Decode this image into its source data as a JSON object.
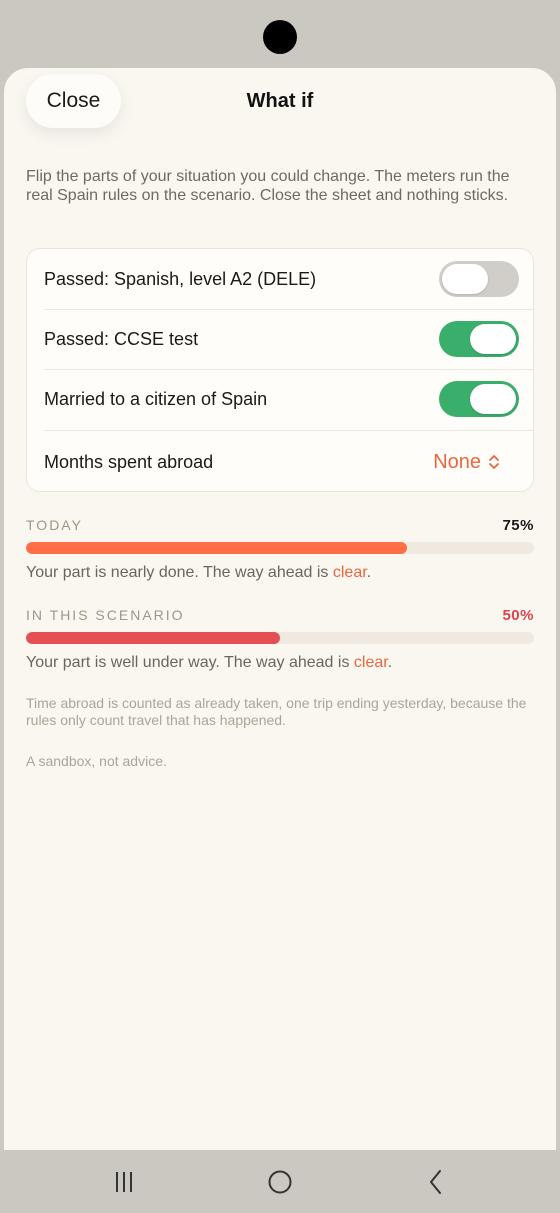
{
  "header": {
    "close_label": "Close",
    "title": "What if"
  },
  "intro": "Flip the parts of your situation you could change. The meters run the real Spain rules on the scenario. Close the sheet and nothing sticks.",
  "options": [
    {
      "label": "Passed: Spanish, level A2 (DELE)",
      "toggle": false
    },
    {
      "label": "Passed: CCSE test",
      "toggle": true
    },
    {
      "label": "Married to a citizen of Spain",
      "toggle": true
    }
  ],
  "months_abroad": {
    "label": "Months spent abroad",
    "value": "None"
  },
  "today": {
    "label": "TODAY",
    "value_text": "75%",
    "progress": 0.75,
    "note_prefix": "Your part is nearly done. The way ahead is ",
    "note_link": "clear",
    "note_suffix": "."
  },
  "scenario": {
    "label": "IN THIS SCENARIO",
    "value_text": "50%",
    "progress": 0.5,
    "note_prefix": "Your part is well under way. The way ahead is ",
    "note_link": "clear",
    "note_suffix": "."
  },
  "footnote": "Time abroad is counted as already taken, one trip ending yesterday, because the rules only count travel that has happened.",
  "disclaimer": "A sandbox, not advice.",
  "colors": {
    "accent_orange": "#e9673f",
    "today_bar": "#ff6e47",
    "scenario_bar": "#e34f52",
    "scenario_value": "#d9444f",
    "toggle_on": "#3aae6b",
    "toggle_off": "#d1ceca"
  },
  "icons": {
    "stepper": "chevron-up-down-icon",
    "nav_recents": "recents-icon",
    "nav_home": "home-icon",
    "nav_back": "back-icon"
  }
}
